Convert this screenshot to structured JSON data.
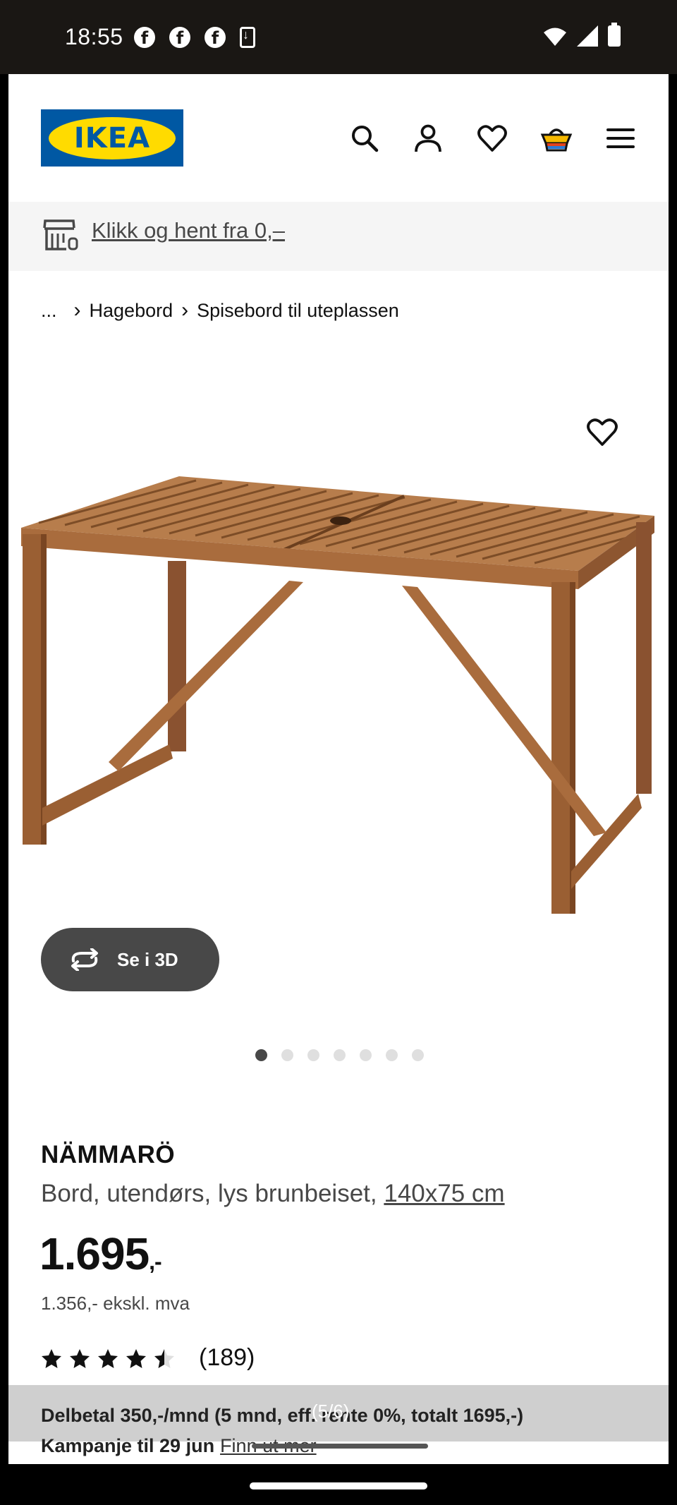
{
  "status_bar": {
    "time": "18:55",
    "left_icons": [
      "facebook-icon",
      "facebook-icon",
      "facebook-icon",
      "download-icon"
    ],
    "right_icons": [
      "wifi-icon",
      "signal-icon",
      "battery-icon"
    ]
  },
  "header": {
    "logo_text": "IKEA",
    "icons": [
      "search-icon",
      "user-icon",
      "heart-icon",
      "cart-icon",
      "menu-icon"
    ],
    "brand_blue": "#0058a3",
    "brand_yellow": "#ffdb00"
  },
  "promo": {
    "link": "Klikk og hent fra 0,–"
  },
  "breadcrumb": {
    "ellipsis": "...",
    "items": [
      "Hagebord",
      "Spisebord til uteplassen"
    ]
  },
  "gallery": {
    "button_3d": "Se i 3D",
    "dot_count": 7,
    "active_dot": 0,
    "counter": "(5/6)"
  },
  "product": {
    "name": "NÄMMARÖ",
    "description": "Bord, utendørs, lys brunbeiset,",
    "size": "140x75 cm",
    "price": "1.695",
    "price_suffix": ",-",
    "price_ex_vat": "1.356,- ekskl. mva",
    "rating": 4.5,
    "review_count": "(189)"
  },
  "installment": {
    "text": "Delbetal 350,-/mnd (5 mnd, eff. rente 0%, totalt 1695,-)",
    "campaign": "Kampanje til 29 jun",
    "more_link": "Finn ut mer"
  }
}
